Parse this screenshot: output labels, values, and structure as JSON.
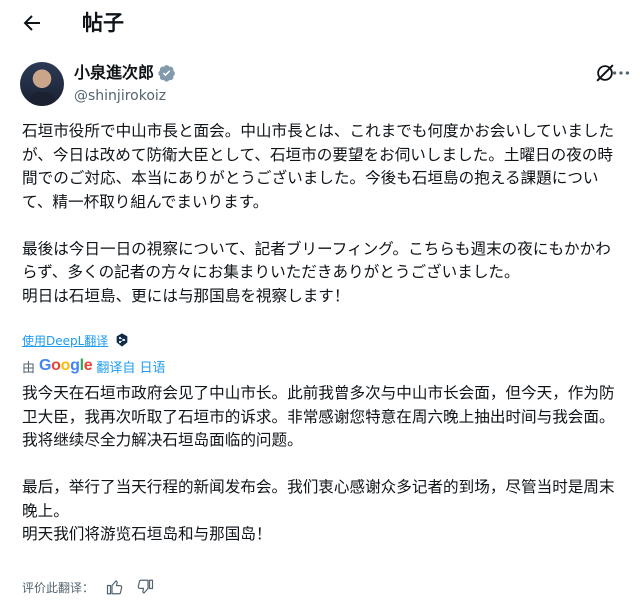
{
  "header": {
    "title": "帖子"
  },
  "author": {
    "name": "小泉進次郎",
    "handle": "@shinjirokoiz"
  },
  "post": {
    "original_p1": "石垣市役所で中山市長と面会。中山市長とは、これまでも何度かお会いしていましたが、今日は改めて防衛大臣として、石垣市の要望をお伺いしました。土曜日の夜の時間でのご対応、本当にありがとうございました。今後も石垣島の抱える課題について、精一杯取り組んでまいります。",
    "original_p2": "最後は今日一日の視察について、記者ブリーフィング。こちらも週末の夜にもかかわらず、多くの記者の方々にお集まりいただきありがとうございました。\n明日は石垣島、更には与那国島を視察します！",
    "deepl_link": "使用DeepL翻译",
    "by_label": "由",
    "google_logo": [
      "G",
      "o",
      "o",
      "g",
      "l",
      "e"
    ],
    "translated_from": "翻译自 日语",
    "translated_p1": "我今天在石垣市政府会见了中山市长。此前我曾多次与中山市长会面，但今天，作为防卫大臣，我再次听取了石垣市的诉求。非常感谢您特意在周六晚上抽出时间与我会面。我将继续尽全力解决石垣岛面临的问题。",
    "translated_p2": "最后，举行了当天行程的新闻发布会。我们衷心感谢众多记者的到场，尽管当时是周末晚上。\n明天我们将游览石垣岛和与那国岛！",
    "rate_label": "评价此翻译："
  },
  "colors": {
    "accent": "#1d9bf0",
    "secondary_text": "#536471",
    "text": "#0f1419"
  },
  "icons": [
    "back-arrow-icon",
    "verified-badge-icon",
    "grok-icon",
    "more-icon",
    "deepl-badge-icon",
    "thumbs-up-icon",
    "thumbs-down-icon"
  ]
}
